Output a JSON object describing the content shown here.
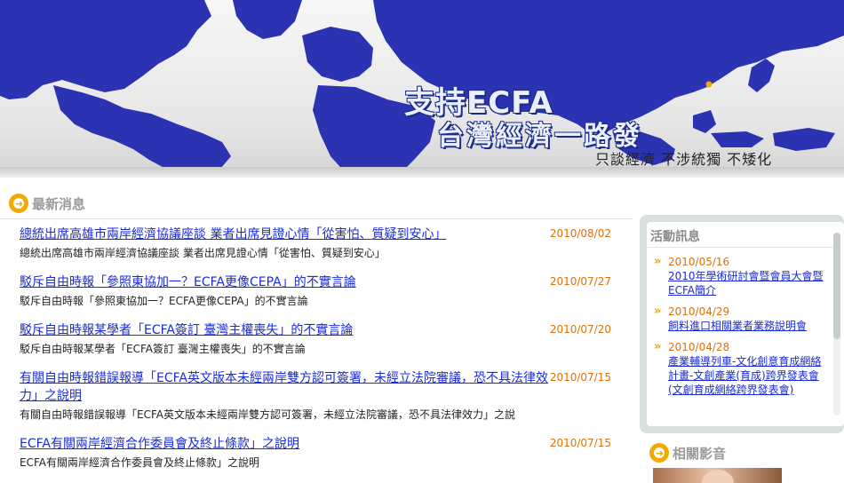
{
  "banner": {
    "title_line1": "支持ECFA",
    "title_line2": "台灣經濟一路發",
    "slogan": "只談經濟  不涉統獨  不矮化",
    "colors": {
      "land": "#2b33b3",
      "sea": "#ececec"
    }
  },
  "news": {
    "header": "最新消息",
    "items": [
      {
        "title": "總統出席高雄市兩岸經濟協議座談 業者出席見證心情「從害怕、質疑到安心」",
        "date": "2010/08/02",
        "summary": "總統出席高雄市兩岸經濟協議座談 業者出席見證心情「從害怕、質疑到安心」"
      },
      {
        "title": "駁斥自由時報「參照東協加一？ECFA更像CEPA」的不實言論",
        "date": "2010/07/27",
        "summary": "駁斥自由時報「參照東協加一？ECFA更像CEPA」的不實言論"
      },
      {
        "title": "駁斥自由時報某學者「ECFA簽訂 臺灣主權喪失」的不實言論",
        "date": "2010/07/20",
        "summary": "駁斥自由時報某學者「ECFA簽訂 臺灣主權喪失」的不實言論"
      },
      {
        "title": "有關自由時報錯誤報導「ECFA英文版本未經兩岸雙方認可簽署，未經立法院審議，恐不具法律效力」之說明",
        "date": "2010/07/15",
        "summary": "有關自由時報錯誤報導「ECFA英文版本未經兩岸雙方認可簽署，未經立法院審議，恐不具法律效力」之說"
      },
      {
        "title": "ECFA有關兩岸經濟合作委員會及終止條款」之說明",
        "date": "2010/07/15",
        "summary": "ECFA有關兩岸經濟合作委員會及終止條款」之說明"
      }
    ]
  },
  "events": {
    "header": "活動訊息",
    "items": [
      {
        "date": "2010/05/16",
        "title": "2010年學術研討會暨會員大會暨ECFA簡介"
      },
      {
        "date": "2010/04/29",
        "title": "飼料進口相關業者業務說明會"
      },
      {
        "date": "2010/04/28",
        "title": "產業輔導列車-文化創意育成網絡計畫-文創產業(育成)跨界發表會(文創育成網絡跨界發表會)"
      }
    ]
  },
  "video": {
    "header": "相關影音"
  }
}
